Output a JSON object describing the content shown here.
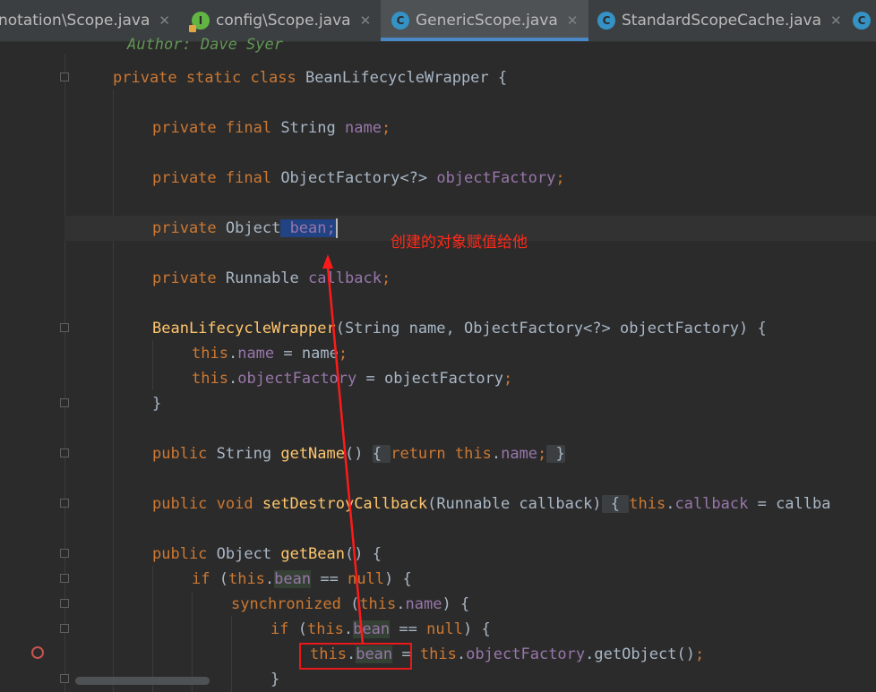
{
  "tabs": [
    {
      "label": "notation\\Scope.java",
      "close": "✕",
      "icon": "",
      "active": false
    },
    {
      "label": "config\\Scope.java",
      "close": "✕",
      "icon": "interface-icon",
      "active": false
    },
    {
      "label": "GenericScope.java",
      "close": "✕",
      "icon": "class-icon",
      "active": true
    },
    {
      "label": "StandardScopeCache.java",
      "close": "✕",
      "icon": "class-icon",
      "active": false
    }
  ],
  "code": {
    "author_comment": "Author: Dave Syer",
    "class_decl": {
      "kw": "private static class",
      "name": "BeanLifecycleWrapper",
      "rest": " {"
    },
    "field_name": {
      "kw": "private final",
      "type": "String",
      "var": "name",
      "end": ";"
    },
    "field_factory": {
      "kw": "private final",
      "type": "ObjectFactory<?>",
      "var": "objectFactory",
      "end": ";"
    },
    "field_bean": {
      "kw": "private",
      "type": "Object",
      "var": " bean;"
    },
    "field_callback": {
      "kw": "private",
      "type": "Runnable",
      "var": "callback",
      "end": ";"
    },
    "ctor": {
      "name": "BeanLifecycleWrapper",
      "params": "(String name, ObjectFactory<?> objectFactory) {"
    },
    "ctor_line1": {
      "this": "this",
      "dot": ".",
      "field": "name",
      "rest": " = name",
      "end": ";"
    },
    "ctor_line2": {
      "this": "this",
      "dot": ".",
      "field": "objectFactory",
      "rest": " = objectFactory",
      "end": ";"
    },
    "close_brace": "}",
    "getname": {
      "kw": "public",
      "type": "String",
      "name": "getName",
      "parens": "()",
      "body_open": "{ ",
      "ret": "return",
      "this": "this",
      "dot": ".",
      "field": "name",
      "semi": ";",
      "body_close": " }"
    },
    "setcb": {
      "kw": "public void",
      "name": "setDestroyCallback",
      "params": "(Runnable callback)",
      "body_open": " { ",
      "this": "this",
      "dot": ".",
      "field": "callback",
      "rest": " = callba"
    },
    "getbean": {
      "kw": "public",
      "type": "Object",
      "name": "getBean",
      "rest": "() {"
    },
    "if1": {
      "kw": "if",
      "open": " (",
      "this": "this",
      "dot": ".",
      "field": "bean",
      "op": " == ",
      "null": "null",
      "rest": ") {"
    },
    "sync": {
      "kw": "synchronized",
      "open": " (",
      "this": "this",
      "dot": ".",
      "field": "name",
      "rest": ") {"
    },
    "if2": {
      "kw": "if",
      "open": " (",
      "this": "this",
      "dot": ".",
      "field": "bean",
      "op": " == ",
      "null": "null",
      "rest": ") {"
    },
    "assign": {
      "this": "this",
      "dot": ".",
      "field": "bean",
      "eq": " = ",
      "this2": "this",
      "dot2": ".",
      "field2": "objectFactory",
      "call": ".getObject()",
      "end": ";"
    },
    "close_brace2": "}"
  },
  "annotation": {
    "text": "创建的对象赋值给他",
    "color": "#ff2a1a"
  },
  "colors": {
    "keyword": "#cc7832",
    "field": "#9876aa",
    "method": "#ffc66d",
    "plain": "#a9b7c6",
    "selection": "#214283",
    "accent": "#4a88c7"
  }
}
